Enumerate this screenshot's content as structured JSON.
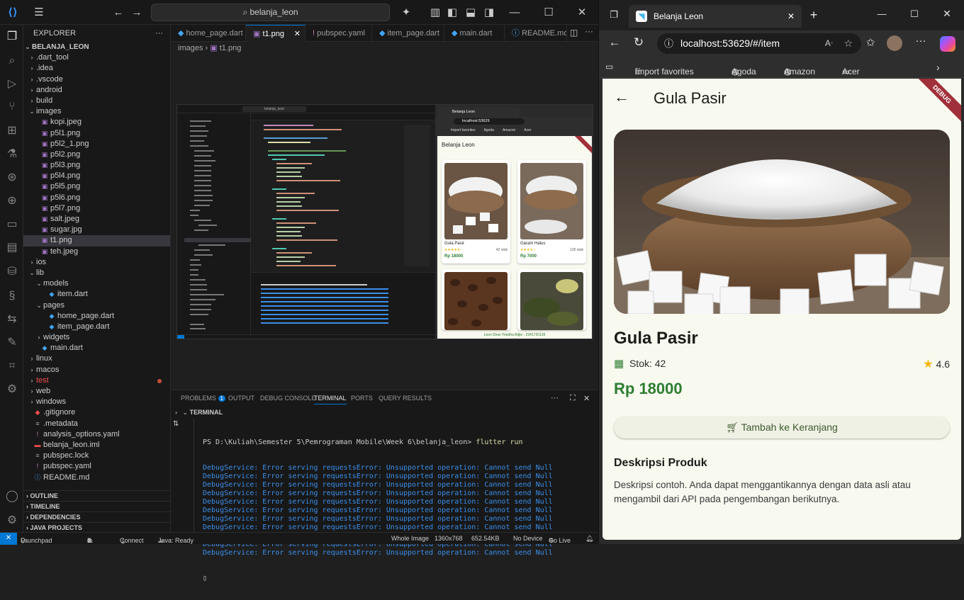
{
  "vscode": {
    "command_center": "belanja_leon",
    "explorer_title": "EXPLORER",
    "project": "BELANJA_LEON",
    "tree": [
      {
        "label": ".dart_tool",
        "indent": 0,
        "type": "folder"
      },
      {
        "label": ".idea",
        "indent": 0,
        "type": "folder"
      },
      {
        "label": ".vscode",
        "indent": 0,
        "type": "folder"
      },
      {
        "label": "android",
        "indent": 0,
        "type": "folder"
      },
      {
        "label": "build",
        "indent": 0,
        "type": "folder"
      },
      {
        "label": "images",
        "indent": 0,
        "type": "folder-open"
      },
      {
        "label": "kopi.jpeg",
        "indent": 1,
        "type": "image"
      },
      {
        "label": "p5l1.png",
        "indent": 1,
        "type": "image"
      },
      {
        "label": "p5l2_1.png",
        "indent": 1,
        "type": "image"
      },
      {
        "label": "p5l2.png",
        "indent": 1,
        "type": "image"
      },
      {
        "label": "p5l3.png",
        "indent": 1,
        "type": "image"
      },
      {
        "label": "p5l4.png",
        "indent": 1,
        "type": "image"
      },
      {
        "label": "p5l5.png",
        "indent": 1,
        "type": "image"
      },
      {
        "label": "p5l6.png",
        "indent": 1,
        "type": "image"
      },
      {
        "label": "p5l7.png",
        "indent": 1,
        "type": "image"
      },
      {
        "label": "salt.jpeg",
        "indent": 1,
        "type": "image"
      },
      {
        "label": "sugar.jpg",
        "indent": 1,
        "type": "image"
      },
      {
        "label": "t1.png",
        "indent": 1,
        "type": "image",
        "selected": true
      },
      {
        "label": "teh.jpeg",
        "indent": 1,
        "type": "image"
      },
      {
        "label": "ios",
        "indent": 0,
        "type": "folder"
      },
      {
        "label": "lib",
        "indent": 0,
        "type": "folder-open"
      },
      {
        "label": "models",
        "indent": 1,
        "type": "folder-open"
      },
      {
        "label": "item.dart",
        "indent": 2,
        "type": "dart"
      },
      {
        "label": "pages",
        "indent": 1,
        "type": "folder-open"
      },
      {
        "label": "home_page.dart",
        "indent": 2,
        "type": "dart"
      },
      {
        "label": "item_page.dart",
        "indent": 2,
        "type": "dart"
      },
      {
        "label": "widgets",
        "indent": 1,
        "type": "folder"
      },
      {
        "label": "main.dart",
        "indent": 1,
        "type": "dart"
      },
      {
        "label": "linux",
        "indent": 0,
        "type": "folder"
      },
      {
        "label": "macos",
        "indent": 0,
        "type": "folder"
      },
      {
        "label": "test",
        "indent": 0,
        "type": "folder-error"
      },
      {
        "label": "web",
        "indent": 0,
        "type": "folder"
      },
      {
        "label": "windows",
        "indent": 0,
        "type": "folder"
      },
      {
        "label": ".gitignore",
        "indent": 0,
        "type": "git"
      },
      {
        "label": ".metadata",
        "indent": 0,
        "type": "file"
      },
      {
        "label": "analysis_options.yaml",
        "indent": 0,
        "type": "yaml"
      },
      {
        "label": "belanja_leon.iml",
        "indent": 0,
        "type": "iml"
      },
      {
        "label": "pubspec.lock",
        "indent": 0,
        "type": "file"
      },
      {
        "label": "pubspec.yaml",
        "indent": 0,
        "type": "yaml"
      },
      {
        "label": "README.md",
        "indent": 0,
        "type": "md"
      }
    ],
    "sections": [
      "OUTLINE",
      "TIMELINE",
      "DEPENDENCIES",
      "JAVA PROJECTS"
    ],
    "tabs": [
      {
        "label": "home_page.dart",
        "icon": "dart"
      },
      {
        "label": "t1.png",
        "icon": "image",
        "active": true
      },
      {
        "label": "pubspec.yaml",
        "icon": "yaml"
      },
      {
        "label": "item_page.dart",
        "icon": "dart"
      },
      {
        "label": "main.dart",
        "icon": "dart"
      },
      {
        "label": "README.md",
        "icon": "md"
      }
    ],
    "breadcrumb": [
      "images",
      "t1.png"
    ],
    "panel_tabs": [
      "PROBLEMS",
      "OUTPUT",
      "DEBUG CONSOLE",
      "TERMINAL",
      "PORTS",
      "QUERY RESULTS"
    ],
    "problems_count": "1",
    "terminal_title": "TERMINAL",
    "terminal_prompt": "PS D:\\Kuliah\\Semester 5\\Pemrograman Mobile\\Week 6\\belanja_leon>",
    "terminal_cmd": "flutter run",
    "terminal_line": "DebugService: Error serving requestsError: Unsupported operation: Cannot send Null",
    "terminal_line_count": 11,
    "status": {
      "launchpad": "Launchpad",
      "errors": "1",
      "warnings": "0",
      "connect": "Connect",
      "java": "Java: Ready",
      "whole_image": "Whole Image",
      "dimensions": "1360x768",
      "size": "652.54KB",
      "device": "No Device",
      "golive": "Go Live"
    }
  },
  "edge": {
    "tab_title": "Belanja Leon",
    "url": "localhost:53629/#/item",
    "favorites": [
      "Import favorites",
      "Agoda",
      "Amazon",
      "Acer"
    ]
  },
  "app": {
    "appbar_title": "Gula Pasir",
    "debug_label": "DEBUG",
    "product_name": "Gula Pasir",
    "stock": "Stok: 42",
    "rating": "4.6",
    "price": "Rp 18000",
    "cart_button": "Tambah ke Keranjang",
    "desc_title": "Deskripsi Produk",
    "desc_text": "Deskripsi contoh. Anda dapat menggantikannya dengan data asli atau mengambil dari API pada pengembangan berikutnya.",
    "colors": {
      "price": "#2e7d32",
      "star": "#f5b301",
      "background": "#f8f9ef"
    }
  },
  "thumbnail": {
    "window_title": "belanja_leon",
    "tab_title": "Belanja Leon",
    "url": "localhost:53629",
    "app_title": "Belanja Leon",
    "footer": "Leon Shan Yoedha Adjie - 2341720136",
    "products": [
      {
        "name": "Gula Pasir",
        "stock": "42 stok",
        "price": "Rp 18000"
      },
      {
        "name": "Garam Halus",
        "stock": "120 stok",
        "price": "Rp 7000"
      },
      {
        "name": "",
        "stock": "",
        "price": ""
      },
      {
        "name": "",
        "stock": "",
        "price": ""
      }
    ]
  }
}
